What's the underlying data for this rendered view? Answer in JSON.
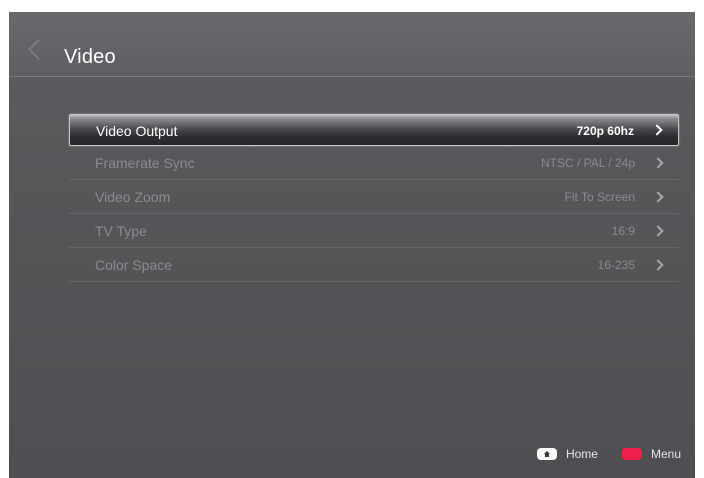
{
  "header": {
    "title": "Video",
    "back_icon": "chevron-left-icon"
  },
  "menu": {
    "items": [
      {
        "label": "Video Output",
        "value": "720p 60hz",
        "selected": true
      },
      {
        "label": "Framerate Sync",
        "value": "NTSC / PAL / 24p",
        "selected": false
      },
      {
        "label": "Video Zoom",
        "value": "Fit To Screen",
        "selected": false
      },
      {
        "label": "TV Type",
        "value": "16:9",
        "selected": false
      },
      {
        "label": "Color Space",
        "value": "16-235",
        "selected": false
      }
    ]
  },
  "footer": {
    "home_label": "Home",
    "menu_label": "Menu",
    "menu_key_color": "#ee1f4b"
  }
}
